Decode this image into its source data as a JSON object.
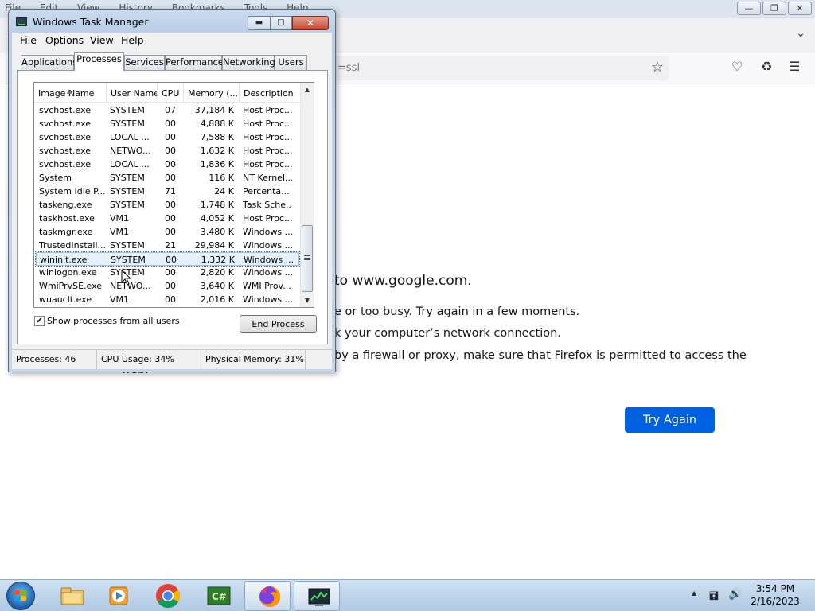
{
  "firefox": {
    "menu": [
      "File",
      "Edit",
      "View",
      "History",
      "Bookmarks",
      "Tools",
      "Help"
    ],
    "url_fragment": "=ssl",
    "error_title": "to www.google.com.",
    "lines": [
      "e or too busy. Try again in a few moments.",
      "k your computer’s network connection.",
      "by a firewall or proxy, make sure that Firefox is permitted to access the"
    ],
    "line_tail": "web.",
    "try_again": "Try Again"
  },
  "task_manager": {
    "title": "Windows Task Manager",
    "menu": [
      "File",
      "Options",
      "View",
      "Help"
    ],
    "tabs": [
      "Applications",
      "Processes",
      "Services",
      "Performance",
      "Networking",
      "Users"
    ],
    "active_tab": "Processes",
    "columns": [
      "Image Name",
      "User Name",
      "CPU",
      "Memory (...",
      "Description"
    ],
    "rows": [
      [
        "svchost.exe",
        "SYSTEM",
        "07",
        "37,184 K",
        "Host Proc..."
      ],
      [
        "svchost.exe",
        "SYSTEM",
        "00",
        "4,888 K",
        "Host Proc..."
      ],
      [
        "svchost.exe",
        "LOCAL ...",
        "00",
        "7,588 K",
        "Host Proc..."
      ],
      [
        "svchost.exe",
        "NETWO...",
        "00",
        "1,632 K",
        "Host Proc..."
      ],
      [
        "svchost.exe",
        "LOCAL ...",
        "00",
        "1,836 K",
        "Host Proc..."
      ],
      [
        "System",
        "SYSTEM",
        "00",
        "116 K",
        "NT Kernel..."
      ],
      [
        "System Idle P...",
        "SYSTEM",
        "71",
        "24 K",
        "Percenta..."
      ],
      [
        "taskeng.exe",
        "SYSTEM",
        "00",
        "1,748 K",
        "Task Sche..."
      ],
      [
        "taskhost.exe",
        "VM1",
        "00",
        "4,052 K",
        "Host Proc..."
      ],
      [
        "taskmgr.exe",
        "VM1",
        "00",
        "3,480 K",
        "Windows ..."
      ],
      [
        "TrustedInstall...",
        "SYSTEM",
        "21",
        "29,984 K",
        "Windows ..."
      ],
      [
        "wininit.exe",
        "SYSTEM",
        "00",
        "1,332 K",
        "Windows ..."
      ],
      [
        "winlogon.exe",
        "SYSTEM",
        "00",
        "2,820 K",
        "Windows ..."
      ],
      [
        "WmiPrvSE.exe",
        "NETWO...",
        "00",
        "3,640 K",
        "WMI Prov..."
      ],
      [
        "wuauclt.exe",
        "VM1",
        "00",
        "2,016 K",
        "Windows ..."
      ]
    ],
    "selected_row": 11,
    "show_all_label": "Show processes from all users",
    "show_all_checked": "✔",
    "end_process": "End Process",
    "status": {
      "processes": "Processes: 46",
      "cpu": "CPU Usage: 34%",
      "memory": "Physical Memory: 31%"
    }
  },
  "taskbar": {
    "apps": [
      {
        "name": "explorer",
        "icon": "folder-icon"
      },
      {
        "name": "media-player",
        "icon": "media-player-icon"
      },
      {
        "name": "chrome",
        "icon": "chrome-icon"
      },
      {
        "name": "csharp-editor",
        "icon": "csharp-icon"
      },
      {
        "name": "firefox",
        "icon": "firefox-icon"
      },
      {
        "name": "task-manager",
        "icon": "task-manager-icon"
      }
    ],
    "time": "3:54 PM",
    "date": "2/16/2023"
  }
}
